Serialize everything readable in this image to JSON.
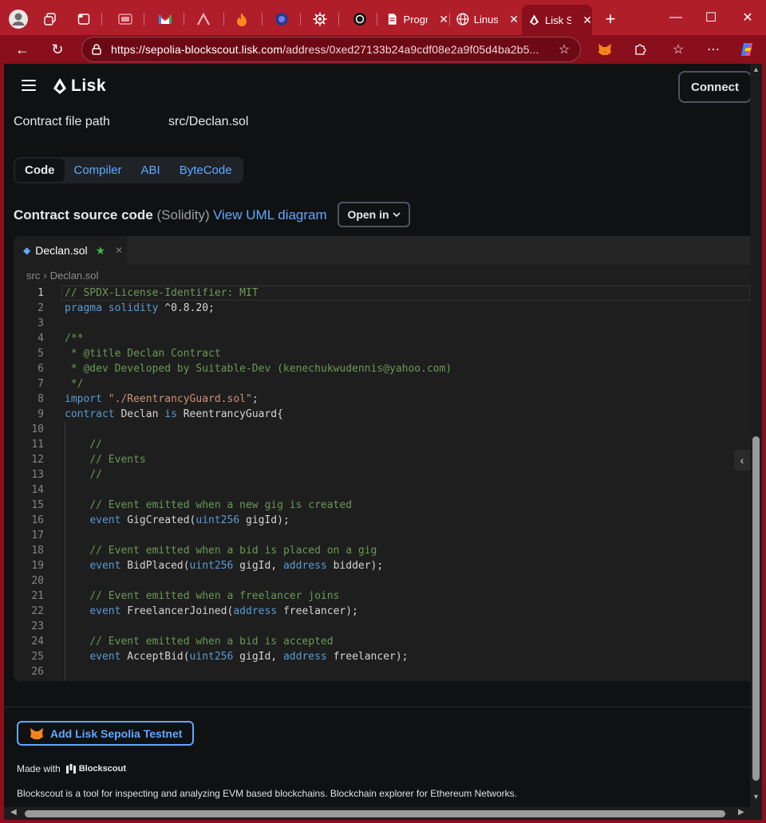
{
  "browser": {
    "tabs": [
      {
        "name": "tab-workspaces",
        "icon": "workspaces-icon"
      },
      {
        "name": "tab-tabactions",
        "icon": "tab-actions-icon"
      },
      {
        "name": "tab-1",
        "icon": "window-icon"
      },
      {
        "name": "tab-gmail",
        "icon": "gmail-icon"
      },
      {
        "name": "tab-3",
        "icon": "caret-logo-icon"
      },
      {
        "name": "tab-4",
        "icon": "flame-icon"
      },
      {
        "name": "tab-5",
        "icon": "orb-icon"
      },
      {
        "name": "tab-6",
        "icon": "gear-icon"
      },
      {
        "name": "tab-7",
        "icon": "chatgpt-icon"
      }
    ],
    "text_tabs": [
      {
        "label": "Progr",
        "icon": "document-icon"
      },
      {
        "label": "Linus",
        "icon": "globe-icon"
      },
      {
        "label": "Lisk S",
        "icon": "lisk-icon",
        "active": true
      }
    ],
    "url_domain": "https://sepolia-blockscout.lisk.com",
    "url_path": "/address/0xed27133b24a9cdf08e2a9f05d4ba2b5...",
    "accent_color": "#b01e2a"
  },
  "header": {
    "logo_text": "Lisk",
    "connect_label": "Connect"
  },
  "contract": {
    "file_path_label": "Contract file path",
    "file_path_value": "src/Declan.sol",
    "tabs": [
      "Code",
      "Compiler",
      "ABI",
      "ByteCode"
    ],
    "active_tab": "Code",
    "source_title": "Contract source code",
    "source_lang": "(Solidity)",
    "uml_link": "View UML diagram",
    "open_in_label": "Open in"
  },
  "editor": {
    "file_tab": "Declan.sol",
    "breadcrumb": [
      "src",
      "Declan.sol"
    ],
    "current_line": 1,
    "lines": [
      [
        [
          "c",
          "// SPDX-License-Identifier: MIT"
        ]
      ],
      [
        [
          "k",
          "pragma"
        ],
        [
          "",
          " "
        ],
        [
          "k",
          "solidity"
        ],
        [
          "",
          " ^0.8.20;"
        ]
      ],
      [],
      [
        [
          "c",
          "/**"
        ]
      ],
      [
        [
          "c",
          " * @title Declan Contract"
        ]
      ],
      [
        [
          "c",
          " * @dev Developed by Suitable-Dev (kenechukwudennis@yahoo.com)"
        ]
      ],
      [
        [
          "c",
          " */"
        ]
      ],
      [
        [
          "k",
          "import"
        ],
        [
          "",
          " "
        ],
        [
          "s",
          "\"./ReentrancyGuard.sol\""
        ],
        [
          "",
          ";"
        ]
      ],
      [
        [
          "k",
          "contract"
        ],
        [
          "",
          " Declan "
        ],
        [
          "k",
          "is"
        ],
        [
          "",
          " ReentrancyGuard{"
        ]
      ],
      [],
      [
        [
          "",
          "    "
        ],
        [
          "c",
          "//"
        ]
      ],
      [
        [
          "",
          "    "
        ],
        [
          "c",
          "// Events"
        ]
      ],
      [
        [
          "",
          "    "
        ],
        [
          "c",
          "//"
        ]
      ],
      [],
      [
        [
          "",
          "    "
        ],
        [
          "c",
          "// Event emitted when a new gig is created"
        ]
      ],
      [
        [
          "",
          "    "
        ],
        [
          "k",
          "event"
        ],
        [
          "",
          " GigCreated("
        ],
        [
          "k",
          "uint256"
        ],
        [
          "",
          " gigId);"
        ]
      ],
      [],
      [
        [
          "",
          "    "
        ],
        [
          "c",
          "// Event emitted when a bid is placed on a gig"
        ]
      ],
      [
        [
          "",
          "    "
        ],
        [
          "k",
          "event"
        ],
        [
          "",
          " BidPlaced("
        ],
        [
          "k",
          "uint256"
        ],
        [
          "",
          " gigId, "
        ],
        [
          "k",
          "address"
        ],
        [
          "",
          " bidder);"
        ]
      ],
      [],
      [
        [
          "",
          "    "
        ],
        [
          "c",
          "// Event emitted when a freelancer joins"
        ]
      ],
      [
        [
          "",
          "    "
        ],
        [
          "k",
          "event"
        ],
        [
          "",
          " FreelancerJoined("
        ],
        [
          "k",
          "address"
        ],
        [
          "",
          " freelancer);"
        ]
      ],
      [],
      [
        [
          "",
          "    "
        ],
        [
          "c",
          "// Event emitted when a bid is accepted"
        ]
      ],
      [
        [
          "",
          "    "
        ],
        [
          "k",
          "event"
        ],
        [
          "",
          " AcceptBid("
        ],
        [
          "k",
          "uint256"
        ],
        [
          "",
          " gigId, "
        ],
        [
          "k",
          "address"
        ],
        [
          "",
          " freelancer);"
        ]
      ],
      [],
      [
        [
          "",
          "    "
        ],
        [
          "c",
          "//"
        ]
      ]
    ],
    "colors": {
      "comment": "#6a9955",
      "keyword": "#569cd6",
      "string": "#ce9178"
    }
  },
  "footer": {
    "add_network_label": "Add Lisk Sepolia Testnet",
    "made_with_label": "Made with",
    "blockscout_label": "Blockscout",
    "description": "Blockscout is a tool for inspecting and analyzing EVM based blockchains. Blockchain explorer for Ethereum Networks."
  }
}
